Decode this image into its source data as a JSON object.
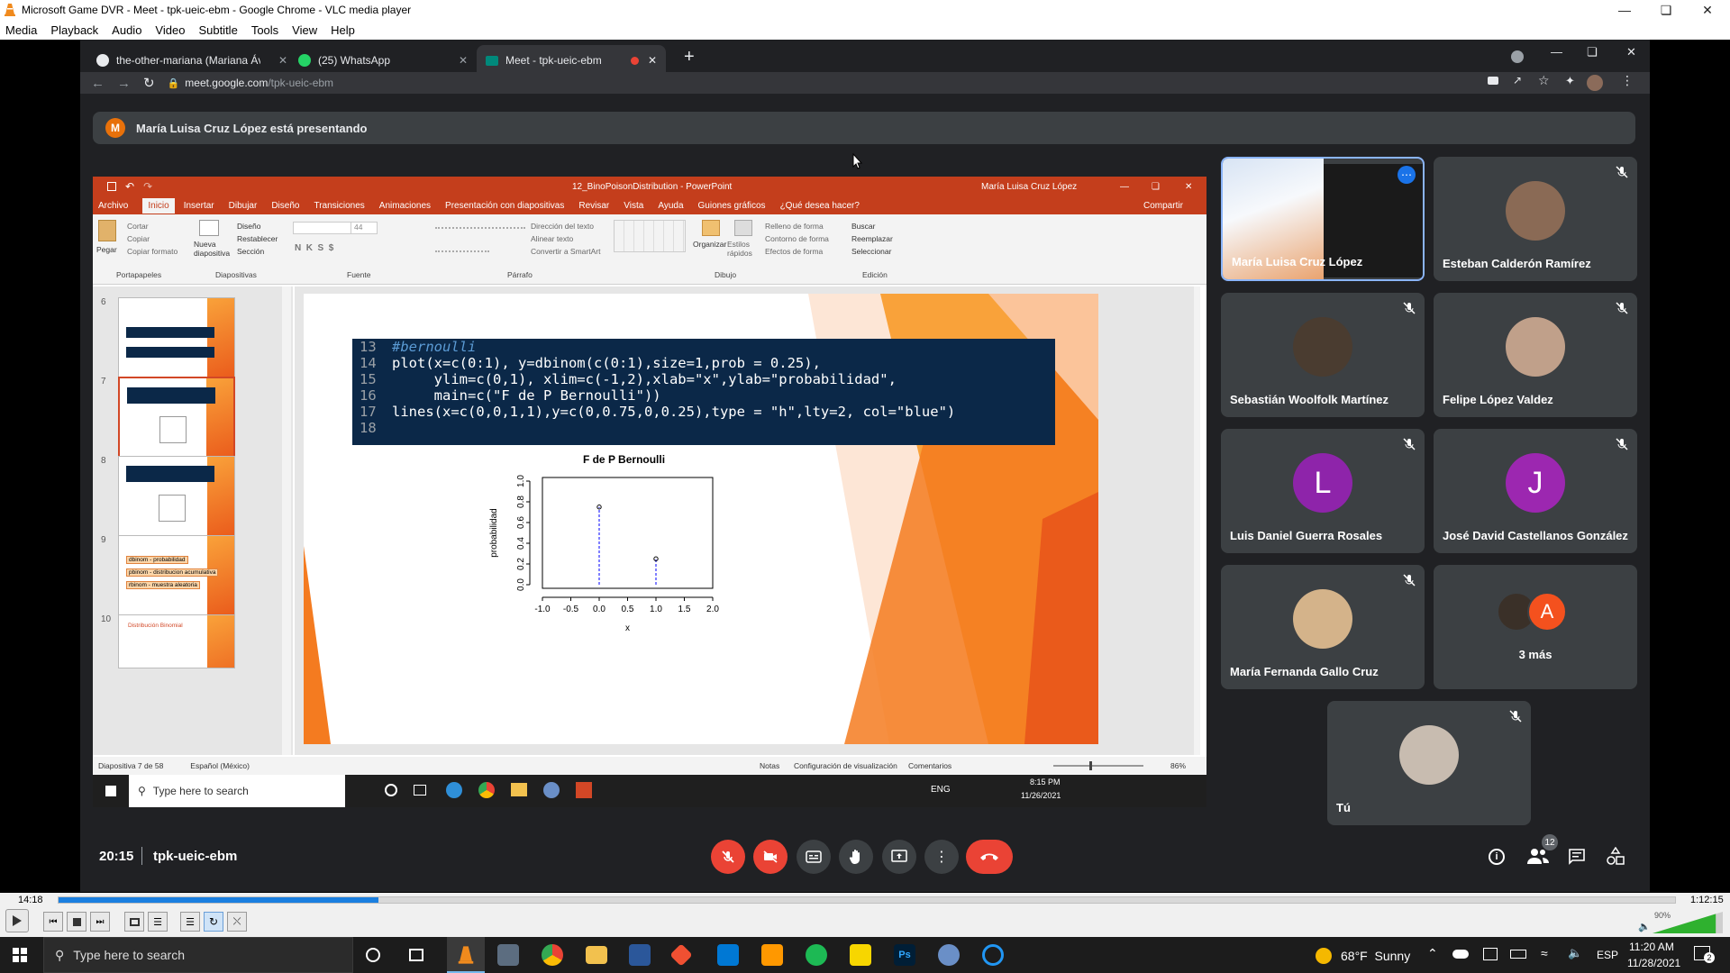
{
  "vlc": {
    "title": "Microsoft Game DVR - Meet - tpk-ueic-ebm - Google Chrome - VLC media player",
    "menu": [
      "Media",
      "Playback",
      "Audio",
      "Video",
      "Subtitle",
      "Tools",
      "View",
      "Help"
    ],
    "time_elapsed": "14:18",
    "time_total": "1:12:15",
    "progress": 0.198,
    "volume_label": "90%",
    "volume": 0.9
  },
  "chrome": {
    "tabs": [
      {
        "label": "the-other-mariana (Mariana Ávalos"
      },
      {
        "label": "(25) WhatsApp"
      },
      {
        "label": "Meet - tpk-ueic-ebm"
      }
    ],
    "url_domain": "meet.google.com",
    "url_path": "/tpk-ueic-ebm"
  },
  "meet": {
    "presenter_initial": "M",
    "banner": "María Luisa Cruz López está presentando",
    "time": "20:15",
    "meeting_code": "tpk-ueic-ebm",
    "people_count": "12",
    "participants": [
      {
        "name": "María Luisa Cruz López"
      },
      {
        "name": "Esteban Calderón Ramírez"
      },
      {
        "name": "Sebastián Woolfolk Martínez"
      },
      {
        "name": "Felipe López Valdez"
      },
      {
        "name": "Luis Daniel Guerra Rosales",
        "initial": "L"
      },
      {
        "name": "José David Castellanos González",
        "initial": "J"
      },
      {
        "name": "María Fernanda Gallo Cruz"
      },
      {
        "name": "3 más",
        "initial": "A"
      },
      {
        "name": "Tú"
      }
    ]
  },
  "ppt": {
    "filename": "12_BinoPoisonDistribution - PowerPoint",
    "user": "María Luisa Cruz López",
    "tabs": [
      "Archivo",
      "Inicio",
      "Insertar",
      "Dibujar",
      "Diseño",
      "Transiciones",
      "Animaciones",
      "Presentación con diapositivas",
      "Revisar",
      "Vista",
      "Ayuda",
      "Guiones gráficos",
      "¿Qué desea hacer?"
    ],
    "share": "Compartir",
    "ribbon": {
      "groups": [
        "Portapapeles",
        "Diapositivas",
        "Fuente",
        "Párrafo",
        "Dibujo",
        "Edición"
      ],
      "pegar": "Pegar",
      "cortar": "Cortar",
      "copiar": "Copiar",
      "copiar_formato": "Copiar formato",
      "nueva": "Nueva diapositiva",
      "diseno": "Diseño",
      "restablecer": "Restablecer",
      "seccion": "Sección",
      "font_size": "44",
      "direccion": "Dirección del texto",
      "alinear": "Alinear texto",
      "convertir": "Convertir a SmartArt",
      "organizar": "Organizar",
      "estilos": "Estilos rápidos",
      "relleno": "Relleno de forma",
      "contorno": "Contorno de forma",
      "efectos": "Efectos de forma",
      "buscar": "Buscar",
      "reemplazar": "Reemplazar",
      "seleccionar": "Seleccionar"
    },
    "thumb_numbers": [
      "6",
      "7",
      "8",
      "9",
      "10"
    ],
    "thumb9_lines": [
      "dbinom - probabilidad",
      "pbinom - distribucion acumulativa",
      "rbinom - muestra aleatoria"
    ],
    "thumb10_title": "Distribución Binomial",
    "code": [
      {
        "n": "13",
        "text": "#bernoulli"
      },
      {
        "n": "14",
        "text": "plot(x=c(0:1), y=dbinom(c(0:1),size=1,prob = 0.25),"
      },
      {
        "n": "15",
        "text": "     ylim=c(0,1), xlim=c(-1,2),xlab=\"x\",ylab=\"probabilidad\","
      },
      {
        "n": "16",
        "text": "     main=c(\"F de P Bernoulli\"))"
      },
      {
        "n": "17",
        "text": "lines(x=c(0,0,1,1),y=c(0,0.75,0,0.25),type = \"h\",lty=2, col=\"blue\")"
      },
      {
        "n": "18",
        "text": ""
      }
    ],
    "status": {
      "slide": "Diapositiva 7 de 58",
      "lang": "Español (México)",
      "notas": "Notas",
      "config": "Configuración de visualización",
      "comentarios": "Comentarios",
      "zoom": "86%"
    },
    "inner_taskbar": {
      "search": "Type here to search",
      "lang": "ENG",
      "time": "8:15 PM",
      "date": "11/26/2021"
    }
  },
  "chart_data": {
    "type": "scatter",
    "title": "F de P Bernoulli",
    "xlabel": "x",
    "ylabel": "probabilidad",
    "xlim": [
      -1,
      2
    ],
    "ylim": [
      0,
      1
    ],
    "xticks": [
      "-1.0",
      "-0.5",
      "0.0",
      "0.5",
      "1.0",
      "1.5",
      "2.0"
    ],
    "yticks": [
      "0.0",
      "0.2",
      "0.4",
      "0.6",
      "0.8",
      "1.0"
    ],
    "points": [
      {
        "x": 0,
        "y": 0.75
      },
      {
        "x": 1,
        "y": 0.25
      }
    ],
    "lines_h": [
      {
        "x": 0,
        "y": 0.75
      },
      {
        "x": 1,
        "y": 0.25
      }
    ],
    "line_color": "blue"
  },
  "taskbar": {
    "search": "Type here to search",
    "weather": "68°F  Sunny",
    "lang": "ESP",
    "time": "11:20 AM",
    "date": "11/28/2021",
    "notifications": "2"
  }
}
